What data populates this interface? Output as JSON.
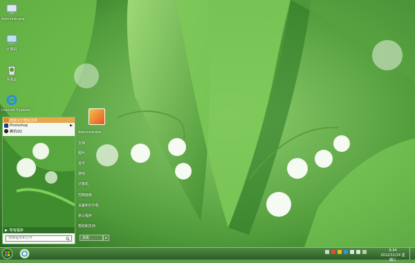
{
  "desktop": {
    "icons": [
      {
        "label": "Administrator",
        "icon": "user-folder-icon"
      },
      {
        "label": "计算机",
        "icon": "computer-icon"
      },
      {
        "label": "回收站",
        "icon": "recycle-bin-icon"
      },
      {
        "label": "Internet Explorer",
        "icon": "ie-icon"
      }
    ]
  },
  "start_menu": {
    "pinned": [
      {
        "label": "自定义个性化文件",
        "icon": "folder-icon",
        "highlighted": true,
        "submenu": false
      },
      {
        "label": "Photoshop",
        "icon": "photoshop-icon",
        "highlighted": false,
        "submenu": true
      },
      {
        "label": "腾讯QQ",
        "icon": "qq-icon",
        "highlighted": false,
        "submenu": false
      }
    ],
    "all_programs": "所有程序",
    "search_placeholder": "搜索程序和文件",
    "user_name": "Administrator",
    "right_items": [
      "文档",
      "图片",
      "音乐",
      "游戏",
      "计算机",
      "控制面板",
      "设备和打印机",
      "默认程序",
      "帮助和支持"
    ],
    "shutdown_label": "关机"
  },
  "taskbar": {
    "clock_time": "9:34",
    "clock_date": "2012/11/14 星期三"
  },
  "colors": {
    "taskbar": "#3b7033",
    "accent": "#e6a84c"
  }
}
